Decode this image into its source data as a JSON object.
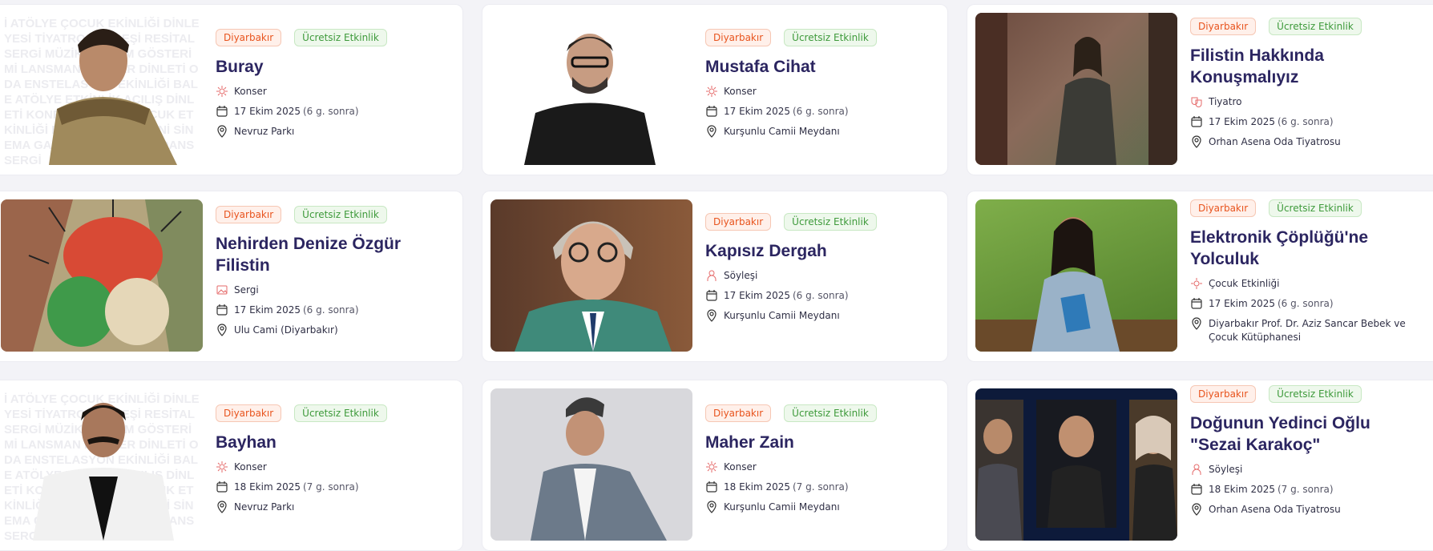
{
  "badges": {
    "city": "Diyarbakır",
    "free": "Ücretsiz Etkinlik"
  },
  "bg_text": "İ ATÖLYE ÇOCUK EKİNLİĞİ DİNLEYESİ TİYATRO SÖYLEŞİ RESİTAL SERGİ MÜZİK ER FİLM GÖSTERİMİ LANSMAN KONSER DİNLETİ ODA ENSTELASYON EKİNLİĞİ BALE ATÖLYE ETKİNLİK ACILIŞ DİNLETİ KONFERANS TAY ÇOCUK ETKİNLİĞİ BALE ÖDÜL TÖRENİ SİNEMA GALA SERİ SEMİNER DANS SERGİ",
  "events": [
    {
      "title": "Buray",
      "category": "Konser",
      "date": "17 Ekim 2025",
      "relative": "(6 g. sonra)",
      "venue": "Nevruz Parkı"
    },
    {
      "title": "Mustafa Cihat",
      "category": "Konser",
      "date": "17 Ekim 2025",
      "relative": "(6 g. sonra)",
      "venue": "Kurşunlu Camii Meydanı"
    },
    {
      "title": "Filistin Hakkında Konuşmalıyız",
      "category": "Tiyatro",
      "date": "17 Ekim 2025",
      "relative": "(6 g. sonra)",
      "venue": "Orhan Asena Oda Tiyatrosu"
    },
    {
      "title": "Nehirden Denize Özgür Filistin",
      "category": "Sergi",
      "date": "17 Ekim 2025",
      "relative": "(6 g. sonra)",
      "venue": "Ulu Cami (Diyarbakır)"
    },
    {
      "title": "Kapısız Dergah",
      "category": "Söyleşi",
      "date": "17 Ekim 2025",
      "relative": "(6 g. sonra)",
      "venue": "Kurşunlu Camii Meydanı"
    },
    {
      "title": "Elektronik Çöplüğü'ne Yolculuk",
      "category": "Çocuk Etkinliği",
      "date": "17 Ekim 2025",
      "relative": "(6 g. sonra)",
      "venue": "Diyarbakır Prof. Dr. Aziz Sancar Bebek ve Çocuk Kütüphanesi"
    },
    {
      "title": "Bayhan",
      "category": "Konser",
      "date": "18 Ekim 2025",
      "relative": "(7 g. sonra)",
      "venue": "Nevruz Parkı"
    },
    {
      "title": "Maher Zain",
      "category": "Konser",
      "date": "18 Ekim 2025",
      "relative": "(7 g. sonra)",
      "venue": "Kurşunlu Camii Meydanı"
    },
    {
      "title": "Doğunun Yedinci Oğlu \"Sezai Karakoç\"",
      "category": "Söyleşi",
      "date": "18 Ekim 2025",
      "relative": "(7 g. sonra)",
      "venue": "Orhan Asena Oda Tiyatrosu"
    }
  ],
  "colors": {
    "city_badge": "#e8541e",
    "free_badge": "#3e9a3b",
    "title": "#2b2560",
    "icon": "#e56a6a"
  }
}
